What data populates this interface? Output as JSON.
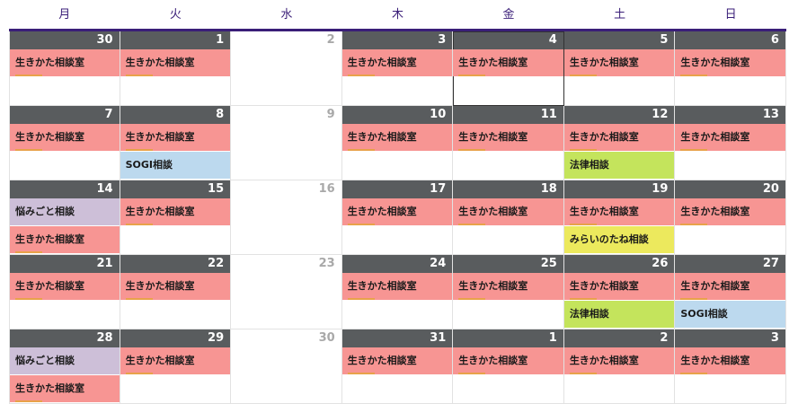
{
  "weekdays": [
    "月",
    "火",
    "水",
    "木",
    "金",
    "土",
    "日"
  ],
  "weeks": [
    [
      {
        "d": "30",
        "e": [
          [
            "pink",
            "生きかた相談室"
          ]
        ]
      },
      {
        "d": "1",
        "e": [
          [
            "pink",
            "生きかた相談室"
          ]
        ]
      },
      {
        "d": "2",
        "closed": true,
        "e": []
      },
      {
        "d": "3",
        "e": [
          [
            "pink",
            "生きかた相談室"
          ]
        ]
      },
      {
        "d": "4",
        "sel": true,
        "e": [
          [
            "pink",
            "生きかた相談室"
          ]
        ]
      },
      {
        "d": "5",
        "e": [
          [
            "pink",
            "生きかた相談室"
          ]
        ]
      },
      {
        "d": "6",
        "e": [
          [
            "pink",
            "生きかた相談室"
          ]
        ]
      }
    ],
    [
      {
        "d": "7",
        "e": [
          [
            "pink",
            "生きかた相談室"
          ]
        ]
      },
      {
        "d": "8",
        "e": [
          [
            "pink",
            "生きかた相談室"
          ],
          [
            "blue",
            "SOGI相談"
          ]
        ]
      },
      {
        "d": "9",
        "closed": true,
        "e": []
      },
      {
        "d": "10",
        "e": [
          [
            "pink",
            "生きかた相談室"
          ]
        ]
      },
      {
        "d": "11",
        "e": [
          [
            "pink",
            "生きかた相談室"
          ]
        ]
      },
      {
        "d": "12",
        "e": [
          [
            "pink",
            "生きかた相談室"
          ],
          [
            "green",
            "法律相談"
          ]
        ]
      },
      {
        "d": "13",
        "e": [
          [
            "pink",
            "生きかた相談室"
          ]
        ]
      }
    ],
    [
      {
        "d": "14",
        "e": [
          [
            "purple",
            "悩みごと相談"
          ],
          [
            "pink",
            "生きかた相談室"
          ]
        ]
      },
      {
        "d": "15",
        "e": [
          [
            "pink",
            "生きかた相談室"
          ]
        ]
      },
      {
        "d": "16",
        "closed": true,
        "e": []
      },
      {
        "d": "17",
        "e": [
          [
            "pink",
            "生きかた相談室"
          ]
        ]
      },
      {
        "d": "18",
        "e": [
          [
            "pink",
            "生きかた相談室"
          ]
        ]
      },
      {
        "d": "19",
        "e": [
          [
            "pink",
            "生きかた相談室"
          ],
          [
            "yellow",
            "みらいのたね相談"
          ]
        ]
      },
      {
        "d": "20",
        "e": [
          [
            "pink",
            "生きかた相談室"
          ]
        ]
      }
    ],
    [
      {
        "d": "21",
        "e": [
          [
            "pink",
            "生きかた相談室"
          ]
        ]
      },
      {
        "d": "22",
        "e": [
          [
            "pink",
            "生きかた相談室"
          ]
        ]
      },
      {
        "d": "23",
        "closed": true,
        "e": []
      },
      {
        "d": "24",
        "e": [
          [
            "pink",
            "生きかた相談室"
          ]
        ]
      },
      {
        "d": "25",
        "e": [
          [
            "pink",
            "生きかた相談室"
          ]
        ]
      },
      {
        "d": "26",
        "e": [
          [
            "pink",
            "生きかた相談室"
          ],
          [
            "green",
            "法律相談"
          ]
        ]
      },
      {
        "d": "27",
        "e": [
          [
            "pink",
            "生きかた相談室"
          ],
          [
            "blue",
            "SOGI相談"
          ]
        ]
      }
    ],
    [
      {
        "d": "28",
        "e": [
          [
            "purple",
            "悩みごと相談"
          ],
          [
            "pink",
            "生きかた相談室"
          ]
        ]
      },
      {
        "d": "29",
        "e": [
          [
            "pink",
            "生きかた相談室"
          ]
        ]
      },
      {
        "d": "30",
        "closed": true,
        "e": []
      },
      {
        "d": "31",
        "e": [
          [
            "pink",
            "生きかた相談室"
          ]
        ]
      },
      {
        "d": "1",
        "e": [
          [
            "pink",
            "生きかた相談室"
          ]
        ]
      },
      {
        "d": "2",
        "e": [
          [
            "pink",
            "生きかた相談室"
          ]
        ]
      },
      {
        "d": "3",
        "e": [
          [
            "pink",
            "生きかた相談室"
          ]
        ]
      }
    ]
  ]
}
